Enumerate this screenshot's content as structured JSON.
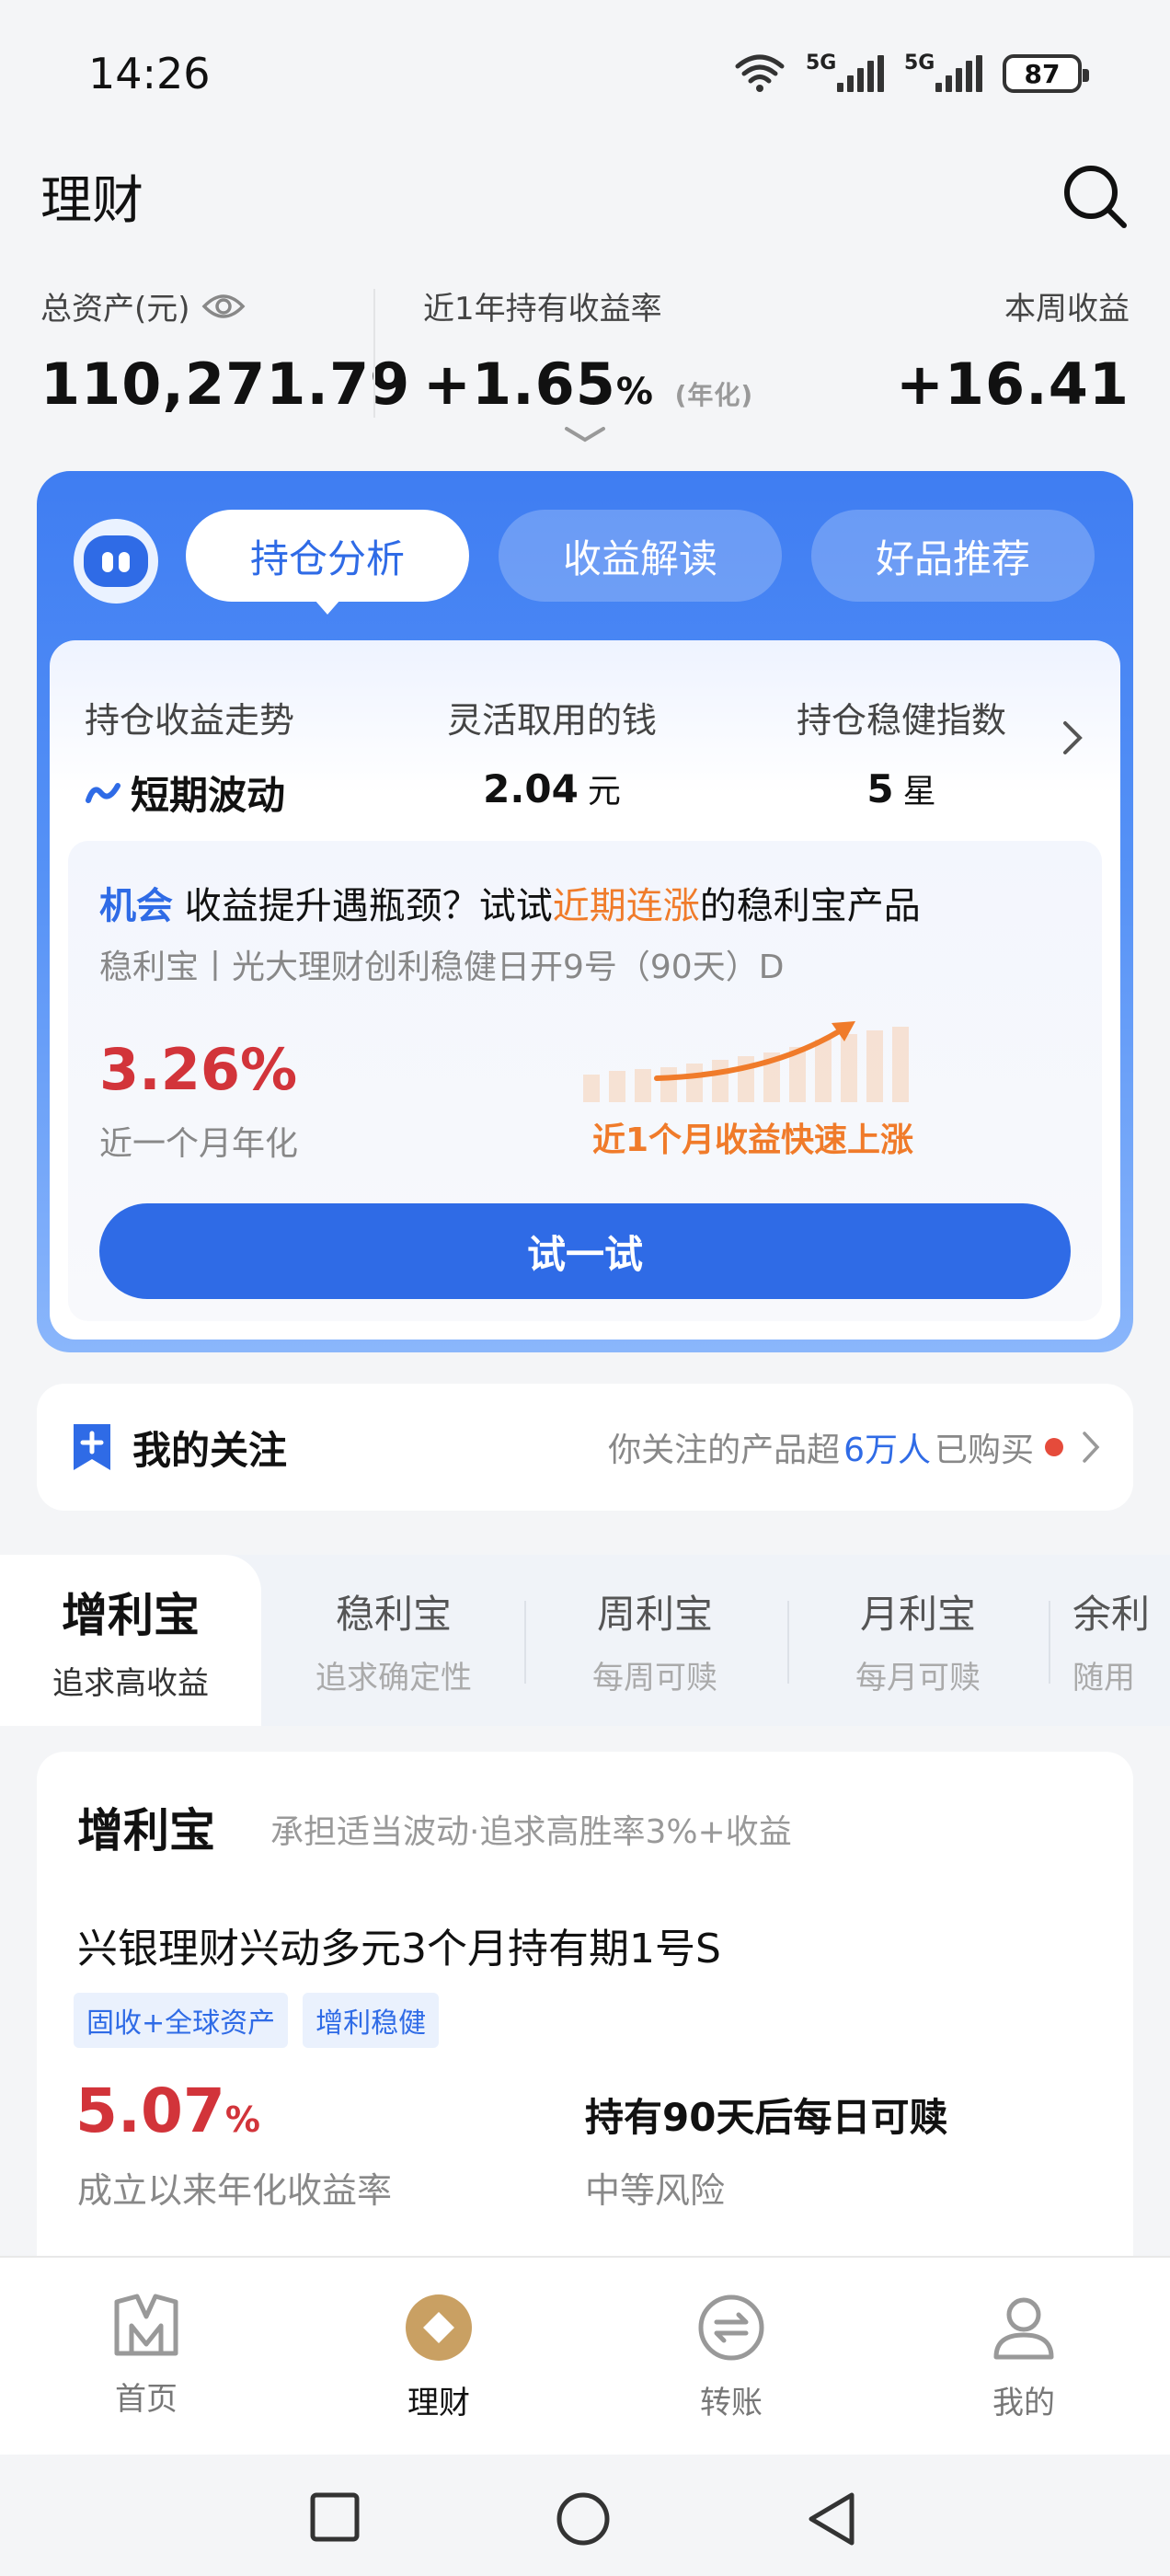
{
  "status_bar": {
    "time": "14:26",
    "network1": "5G",
    "network2": "5G",
    "battery": "87"
  },
  "header": {
    "title": "理财"
  },
  "assets": {
    "total_label": "总资产(元)",
    "total_value": "110,271.79",
    "yield_label": "近1年持有收益率",
    "yield_value": "+1.65",
    "yield_unit": "%",
    "yield_sub": "(年化)",
    "week_label": "本周收益",
    "week_value": "+16.41"
  },
  "analysis": {
    "tabs": [
      "持仓分析",
      "收益解读",
      "好品推荐"
    ],
    "metrics": [
      {
        "label": "持仓收益走势",
        "value": "短期波动"
      },
      {
        "label": "灵活取用的钱",
        "value": "2.04",
        "unit": "元"
      },
      {
        "label": "持仓稳健指数",
        "value": "5",
        "unit": "星"
      }
    ],
    "opportunity": {
      "tag": "机会",
      "text_before": "收益提升遇瓶颈？试试",
      "highlight": "近期连涨",
      "text_after": "的稳利宝产品",
      "subtitle": "稳利宝丨光大理财创利稳健日开9号（90天）D",
      "rate": "3.26%",
      "rate_label": "近一个月年化",
      "rise_text": "近1个月收益快速上涨",
      "button": "试一试"
    }
  },
  "follow": {
    "title": "我的关注",
    "text_before": "你关注的产品超",
    "highlight": "6万人",
    "text_after": "已购买"
  },
  "product_tabs": [
    {
      "name": "增利宝",
      "desc": "追求高收益"
    },
    {
      "name": "稳利宝",
      "desc": "追求确定性"
    },
    {
      "name": "周利宝",
      "desc": "每周可赎"
    },
    {
      "name": "月利宝",
      "desc": "每月可赎"
    },
    {
      "name": "余利",
      "desc": "随用"
    }
  ],
  "product_card": {
    "name": "增利宝",
    "desc": "承担适当波动·追求高胜率3%+收益",
    "title": "兴银理财兴动多元3个月持有期1号S",
    "tags": [
      "固收+全球资产",
      "增利稳健"
    ],
    "rate": "5.07",
    "rate_unit": "%",
    "rate_label": "成立以来年化收益率",
    "redeem": "持有90天后每日可赎",
    "risk": "中等风险"
  },
  "bottom_nav": [
    {
      "label": "首页",
      "icon": "home-icon"
    },
    {
      "label": "理财",
      "icon": "wealth-icon"
    },
    {
      "label": "转账",
      "icon": "transfer-icon"
    },
    {
      "label": "我的",
      "icon": "profile-icon"
    }
  ],
  "colors": {
    "primary": "#2f6be6",
    "red": "#d2343a",
    "orange": "#f07b2a",
    "gold": "#c9a063"
  }
}
